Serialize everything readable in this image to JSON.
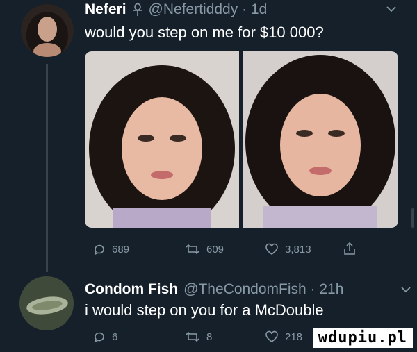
{
  "tweet1": {
    "display_name": "Neferi",
    "handle_time": "@Nefertidddy · 1d",
    "text": "would you step on me for $10 000?",
    "actions": {
      "replies": "689",
      "retweets": "609",
      "likes": "3,813"
    }
  },
  "tweet2": {
    "display_name": "Condom Fish",
    "handle_time": "@TheCondomFish · 21h",
    "text": "i would step on you for a McDouble",
    "actions": {
      "replies": "6",
      "retweets": "8",
      "likes": "218"
    }
  },
  "icons": {
    "verified": "ankh-icon",
    "more": "chevron-down-icon",
    "reply": "reply-icon",
    "retweet": "retweet-icon",
    "like": "heart-icon",
    "share": "share-icon"
  },
  "watermark": "wdupiu.pl",
  "colors": {
    "background": "#15202b",
    "secondary_text": "#8899a6",
    "line": "#38444d"
  }
}
